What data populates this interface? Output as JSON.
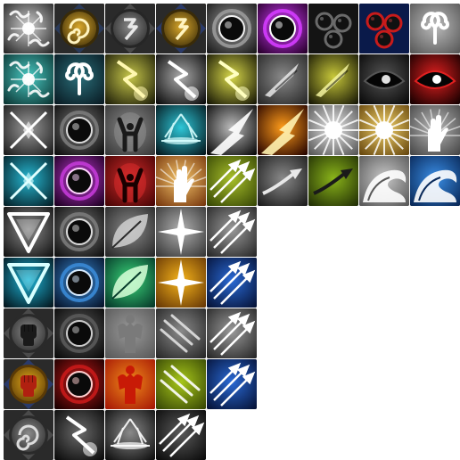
{
  "sheet": {
    "background": "#ffffff",
    "rows": [
      {
        "icons": [
          {
            "name": "wind-swirl-icon",
            "kind": "wind",
            "bg1": "#cfcfcf",
            "bg2": "#2a2a2a",
            "fg": "#ffffff"
          },
          {
            "name": "gold-spiral-medallion-icon",
            "kind": "medal-spiral",
            "bg1": "#d8a72b",
            "bg2": "#3a2b08",
            "fg": "#fff4c0",
            "frame": "#2a3a5a"
          },
          {
            "name": "grey-rune-medallion-icon",
            "kind": "medal-rune",
            "bg1": "#8a8a8a",
            "bg2": "#262626",
            "fg": "#e8e8e8",
            "frame": "#4a4a4a"
          },
          {
            "name": "gold-rune-medallion-icon",
            "kind": "medal-rune",
            "bg1": "#d8a72b",
            "bg2": "#3a2b08",
            "fg": "#fff4c0",
            "frame": "#2a3a6a"
          },
          {
            "name": "grey-orb-ring-icon",
            "kind": "orb",
            "bg1": "#9a9a9a",
            "bg2": "#1c1c1c",
            "fg": "#f0f0f0"
          },
          {
            "name": "purple-orb-ring-icon",
            "kind": "orb",
            "bg1": "#d43cff",
            "bg2": "#2a002e",
            "fg": "#ffffff"
          },
          {
            "name": "grey-triple-orbs-icon",
            "kind": "triorb",
            "bg1": "#6a6a6a",
            "bg2": "#141414",
            "fg": "#d8d8d8"
          },
          {
            "name": "red-blue-triple-orbs-icon",
            "kind": "triorb",
            "bg1": "#c81b1b",
            "bg2": "#0a1a4a",
            "fg": "#ff4d4d"
          },
          {
            "name": "white-ram-horns-icon",
            "kind": "ram",
            "bg1": "#bcbcbc",
            "bg2": "#5a5a5a",
            "fg": "#ffffff"
          }
        ]
      },
      {
        "icons": [
          {
            "name": "teal-wind-swirl-icon",
            "kind": "wind",
            "bg1": "#48c9c2",
            "bg2": "#0d3836",
            "fg": "#ffffff"
          },
          {
            "name": "ram-horns-icon",
            "kind": "ram",
            "bg1": "#2a6f7a",
            "bg2": "#0a1c24",
            "fg": "#ffffff"
          },
          {
            "name": "gold-lightning-strike-icon",
            "kind": "lightning",
            "bg1": "#c6c64a",
            "bg2": "#22220a",
            "fg": "#fff8b0"
          },
          {
            "name": "grey-lightning-burst-icon",
            "kind": "lightning",
            "bg1": "#aaaaaa",
            "bg2": "#0e0e0e",
            "fg": "#ffffff"
          },
          {
            "name": "yellow-lightning-burst-icon",
            "kind": "lightning",
            "bg1": "#d8d84a",
            "bg2": "#1a1a06",
            "fg": "#ffffc0"
          },
          {
            "name": "grey-slash-claw-icon",
            "kind": "slash",
            "bg1": "#8a8a8a",
            "bg2": "#2a2a2a",
            "fg": "#e8e8e8"
          },
          {
            "name": "olive-slash-claw-icon",
            "kind": "slash",
            "bg1": "#c8c83a",
            "bg2": "#1a1a06",
            "fg": "#f4f4a0"
          },
          {
            "name": "dark-eye-icon",
            "kind": "eye",
            "bg1": "#555555",
            "bg2": "#0a0a0a",
            "fg": "#e0e0e0"
          },
          {
            "name": "red-eye-icon",
            "kind": "eye",
            "bg1": "#e02020",
            "bg2": "#1a0000",
            "fg": "#ffffff"
          }
        ]
      },
      {
        "icons": [
          {
            "name": "grey-cross-blades-icon",
            "kind": "cross",
            "bg1": "#9a9a9a",
            "bg2": "#1e1e1e",
            "fg": "#ffffff"
          },
          {
            "name": "grey-orb-icon",
            "kind": "orb",
            "bg1": "#7a7a7a",
            "bg2": "#0e0e0e",
            "fg": "#dcdcdc"
          },
          {
            "name": "grey-raised-arms-figure-icon",
            "kind": "figure",
            "bg1": "#8a8a8a",
            "bg2": "#3a3a3a",
            "fg": "#1a1a1a"
          },
          {
            "name": "cyan-spike-burst-icon",
            "kind": "spikeburst",
            "bg1": "#2ec7d8",
            "bg2": "#061a20",
            "fg": "#d8ffff"
          },
          {
            "name": "grey-dash-streak-icon",
            "kind": "dash",
            "bg1": "#bdbdbd",
            "bg2": "#0c0c0c",
            "fg": "#ffffff"
          },
          {
            "name": "fire-dash-streak-icon",
            "kind": "dash",
            "bg1": "#ff9c1a",
            "bg2": "#2a0600",
            "fg": "#fff2b0"
          },
          {
            "name": "white-radiant-burst-icon",
            "kind": "burst",
            "bg1": "#e6e6e6",
            "bg2": "#5a5a5a",
            "fg": "#ffffff"
          },
          {
            "name": "gold-radiant-burst-icon",
            "kind": "burst",
            "bg1": "#f4d36a",
            "bg2": "#6a4a10",
            "fg": "#ffffff"
          },
          {
            "name": "grey-glowing-hand-icon",
            "kind": "hand",
            "bg1": "#b8b8b8",
            "bg2": "#4a4a4a",
            "fg": "#ffffff"
          }
        ]
      },
      {
        "icons": [
          {
            "name": "cyan-cross-blades-icon",
            "kind": "cross",
            "bg1": "#27b7d1",
            "bg2": "#05222a",
            "fg": "#e0ffff"
          },
          {
            "name": "magenta-orb-icon",
            "kind": "orb",
            "bg1": "#c23ad6",
            "bg2": "#1e0022",
            "fg": "#ffd6ff"
          },
          {
            "name": "red-raised-arms-figure-icon",
            "kind": "figure",
            "bg1": "#d22a2a",
            "bg2": "#4a0606",
            "fg": "#1a0000"
          },
          {
            "name": "gold-glowing-hand-icon",
            "kind": "hand",
            "bg1": "#f6c66a",
            "bg2": "#7a3a10",
            "fg": "#ffffff"
          },
          {
            "name": "lime-triple-arrows-icon",
            "kind": "arrows",
            "bg1": "#a8c02a",
            "bg2": "#3a4a06",
            "fg": "#ffffff"
          },
          {
            "name": "grey-arrow-streak-icon",
            "kind": "arrow",
            "bg1": "#8a8a8a",
            "bg2": "#1e1e1e",
            "fg": "#e8e8e8"
          },
          {
            "name": "lime-arrow-streak-icon",
            "kind": "arrow",
            "bg1": "#8ab41a",
            "bg2": "#243206",
            "fg": "#1a1a1a"
          },
          {
            "name": "grey-wave-icon",
            "kind": "wave",
            "bg1": "#c8c8c8",
            "bg2": "#5a5a5a",
            "fg": "#ffffff"
          },
          {
            "name": "blue-wave-icon",
            "kind": "wave",
            "bg1": "#3a8ee6",
            "bg2": "#0a2a5a",
            "fg": "#ffffff"
          }
        ]
      },
      {
        "icons": [
          {
            "name": "grey-triangle-shield-icon",
            "kind": "triangle",
            "bg1": "#8a8a8a",
            "bg2": "#141414",
            "fg": "#ffffff"
          },
          {
            "name": "grey-orb-icon",
            "kind": "orb",
            "bg1": "#7a7a7a",
            "bg2": "#101010",
            "fg": "#dcdcdc"
          },
          {
            "name": "grey-leaf-icon",
            "kind": "leaf",
            "bg1": "#8a8a8a",
            "bg2": "#2a2a2a",
            "fg": "#d0d0d0"
          },
          {
            "name": "grey-star-flash-icon",
            "kind": "star",
            "bg1": "#b0b0b0",
            "bg2": "#3a3a3a",
            "fg": "#ffffff"
          },
          {
            "name": "grey-triple-arrows-icon",
            "kind": "arrows",
            "bg1": "#9a9a9a",
            "bg2": "#2a2a2a",
            "fg": "#ffffff"
          }
        ]
      },
      {
        "icons": [
          {
            "name": "cyan-triangle-shield-icon",
            "kind": "triangle",
            "bg1": "#1eb4d6",
            "bg2": "#041820",
            "fg": "#d8ffff"
          },
          {
            "name": "blue-orb-icon",
            "kind": "orb",
            "bg1": "#3a8ad6",
            "bg2": "#06142a",
            "fg": "#d8ecff"
          },
          {
            "name": "green-leaf-icon",
            "kind": "leaf",
            "bg1": "#3ad67a",
            "bg2": "#063a2a",
            "fg": "#d8ffd8"
          },
          {
            "name": "gold-star-flash-icon",
            "kind": "star",
            "bg1": "#f6b41a",
            "bg2": "#6a3a06",
            "fg": "#ffffff"
          },
          {
            "name": "blue-triple-arrows-icon",
            "kind": "arrows",
            "bg1": "#2a6ad6",
            "bg2": "#06143a",
            "fg": "#ffffff"
          }
        ]
      },
      {
        "icons": [
          {
            "name": "grey-fist-medallion-icon",
            "kind": "fist",
            "bg1": "#8a8a8a",
            "bg2": "#2a2a2a",
            "fg": "#1a1a1a",
            "frame": "#4a4a4a"
          },
          {
            "name": "dark-orb-icon",
            "kind": "orb",
            "bg1": "#5a5a5a",
            "bg2": "#0a0a0a",
            "fg": "#cccccc"
          },
          {
            "name": "grey-shadow-figure-icon",
            "kind": "figure2",
            "bg1": "#9a9a9a",
            "bg2": "#5a5a5a",
            "fg": "#7a7a7a"
          },
          {
            "name": "grey-arrow-volley-icon",
            "kind": "volley",
            "bg1": "#8a8a8a",
            "bg2": "#2a2a2a",
            "fg": "#e0e0e0"
          },
          {
            "name": "grey-arrow-volley-alt-icon",
            "kind": "arrows",
            "bg1": "#9a9a9a",
            "bg2": "#2a2a2a",
            "fg": "#ffffff"
          }
        ]
      },
      {
        "icons": [
          {
            "name": "gold-fist-medallion-icon",
            "kind": "fist",
            "bg1": "#e0a81a",
            "bg2": "#5a3a06",
            "fg": "#b02010",
            "frame": "#2a3a6a"
          },
          {
            "name": "red-orb-icon",
            "kind": "orb",
            "bg1": "#c81a1a",
            "bg2": "#1a0000",
            "fg": "#ffd0d0"
          },
          {
            "name": "red-flexing-figure-icon",
            "kind": "figure2",
            "bg1": "#f08a1a",
            "bg2": "#a81a06",
            "fg": "#c81a06"
          },
          {
            "name": "lime-arrow-volley-icon",
            "kind": "volley",
            "bg1": "#a8c81a",
            "bg2": "#3a4a06",
            "fg": "#ffffff"
          },
          {
            "name": "blue-arrow-volley-icon",
            "kind": "arrows",
            "bg1": "#2a6ad6",
            "bg2": "#06143a",
            "fg": "#ffffff"
          }
        ]
      },
      {
        "icons": [
          {
            "name": "grey-spiral-medallion-icon",
            "kind": "medal-spiral",
            "bg1": "#8a8a8a",
            "bg2": "#2a2a2a",
            "fg": "#dcdcdc",
            "frame": "#4a4a4a"
          },
          {
            "name": "grey-lightning-zigzag-icon",
            "kind": "lightning",
            "bg1": "#6a6a6a",
            "bg2": "#0c0c0c",
            "fg": "#ffffff"
          },
          {
            "name": "grey-spike-burst-icon",
            "kind": "spikeburst",
            "bg1": "#8a8a8a",
            "bg2": "#101010",
            "fg": "#ffffff"
          },
          {
            "name": "grey-arrow-pair-icon",
            "kind": "arrows",
            "bg1": "#5a5a5a",
            "bg2": "#0c0c0c",
            "fg": "#ffffff"
          }
        ]
      }
    ]
  }
}
